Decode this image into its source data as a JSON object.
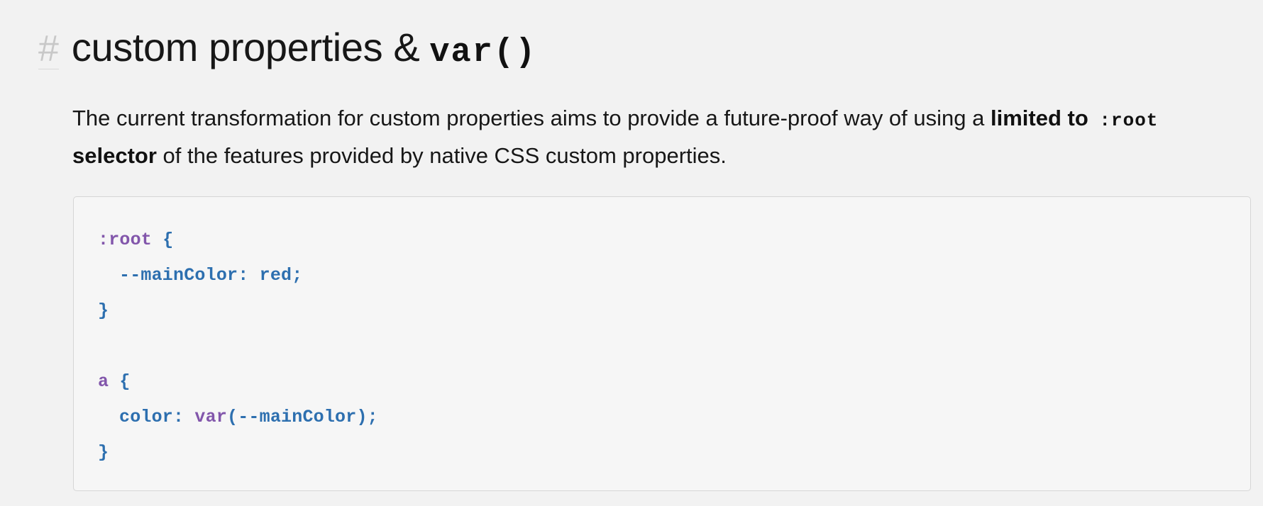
{
  "heading": {
    "anchor": "#",
    "text": "custom properties & ",
    "code": "var()"
  },
  "paragraph": {
    "line1_text": "The current transformation for custom properties aims to provide a future-proof way of using a ",
    "strong_prefix": "limited to",
    "code": ":root",
    "line2_strong": "selector",
    "line2_text": " of the features provided by native CSS custom properties."
  },
  "code_block": {
    "line1": {
      "selector": ":root",
      "brace": " {"
    },
    "line2": {
      "property": "--mainColor",
      "separator": ": ",
      "value": "red;"
    },
    "line3": {
      "brace": "}"
    },
    "line5": {
      "selector": "a",
      "brace": " {"
    },
    "line6": {
      "property": "color",
      "separator": ": ",
      "function": "var",
      "arguments": "(--mainColor);"
    },
    "line7": {
      "brace": "}"
    }
  },
  "colors": {
    "background": "#f2f2f2",
    "code_background": "#f6f6f6",
    "code_border": "#d6d6d6",
    "syntax_purple": "#8256ab",
    "syntax_blue": "#2d6faf",
    "anchor_gray": "#c8c8c8"
  }
}
